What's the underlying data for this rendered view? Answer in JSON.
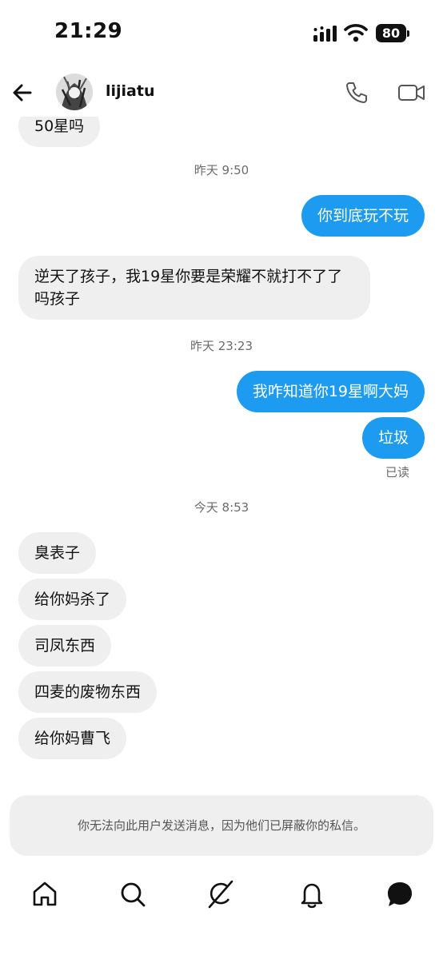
{
  "status_bar": {
    "time": "21:29",
    "battery": "80"
  },
  "header": {
    "username": "lijiatu"
  },
  "messages": [
    {
      "text": "50星吗",
      "direction": "in"
    },
    {
      "timestamp": "昨天 9:50"
    },
    {
      "text": "你到底玩不玩",
      "direction": "out"
    },
    {
      "text": "逆天了孩子，我19星你要是荣耀不就打不了了吗孩子",
      "direction": "in"
    },
    {
      "timestamp": "昨天 23:23"
    },
    {
      "text": "我咋知道你19星啊大妈",
      "direction": "out"
    },
    {
      "text": "垃圾",
      "direction": "out",
      "receipt": "已读"
    },
    {
      "timestamp": "今天 8:53"
    },
    {
      "text": "臭表子",
      "direction": "in"
    },
    {
      "text": "给你妈杀了",
      "direction": "in"
    },
    {
      "text": "司凤东西",
      "direction": "in"
    },
    {
      "text": "四麦的废物东西",
      "direction": "in"
    },
    {
      "text": "给你妈曹飞",
      "direction": "in"
    }
  ],
  "blocked_notice": "你无法向此用户发送消息，因为他们已屏蔽你的私信。",
  "nav": {
    "items": [
      "home-icon",
      "search-icon",
      "grok-icon",
      "notifications-icon",
      "messages-icon"
    ]
  },
  "colors": {
    "accent": "#1d9bf0",
    "incoming_bubble": "#efefef"
  }
}
